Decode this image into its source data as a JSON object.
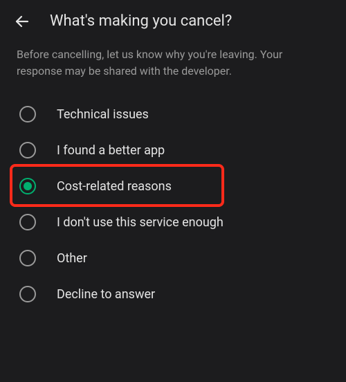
{
  "header": {
    "title": "What's making you cancel?"
  },
  "description": "Before cancelling, let us know why you're leaving. Your response may be shared with the developer.",
  "options": [
    {
      "label": "Technical issues",
      "selected": false
    },
    {
      "label": "I found a better app",
      "selected": false
    },
    {
      "label": "Cost-related reasons",
      "selected": true,
      "highlighted": true
    },
    {
      "label": "I don't use this service enough",
      "selected": false
    },
    {
      "label": "Other",
      "selected": false
    },
    {
      "label": "Decline to answer",
      "selected": false
    }
  ],
  "colors": {
    "accent": "#00b06f",
    "highlight": "#ff2a1a",
    "background": "#1c1c1e"
  }
}
